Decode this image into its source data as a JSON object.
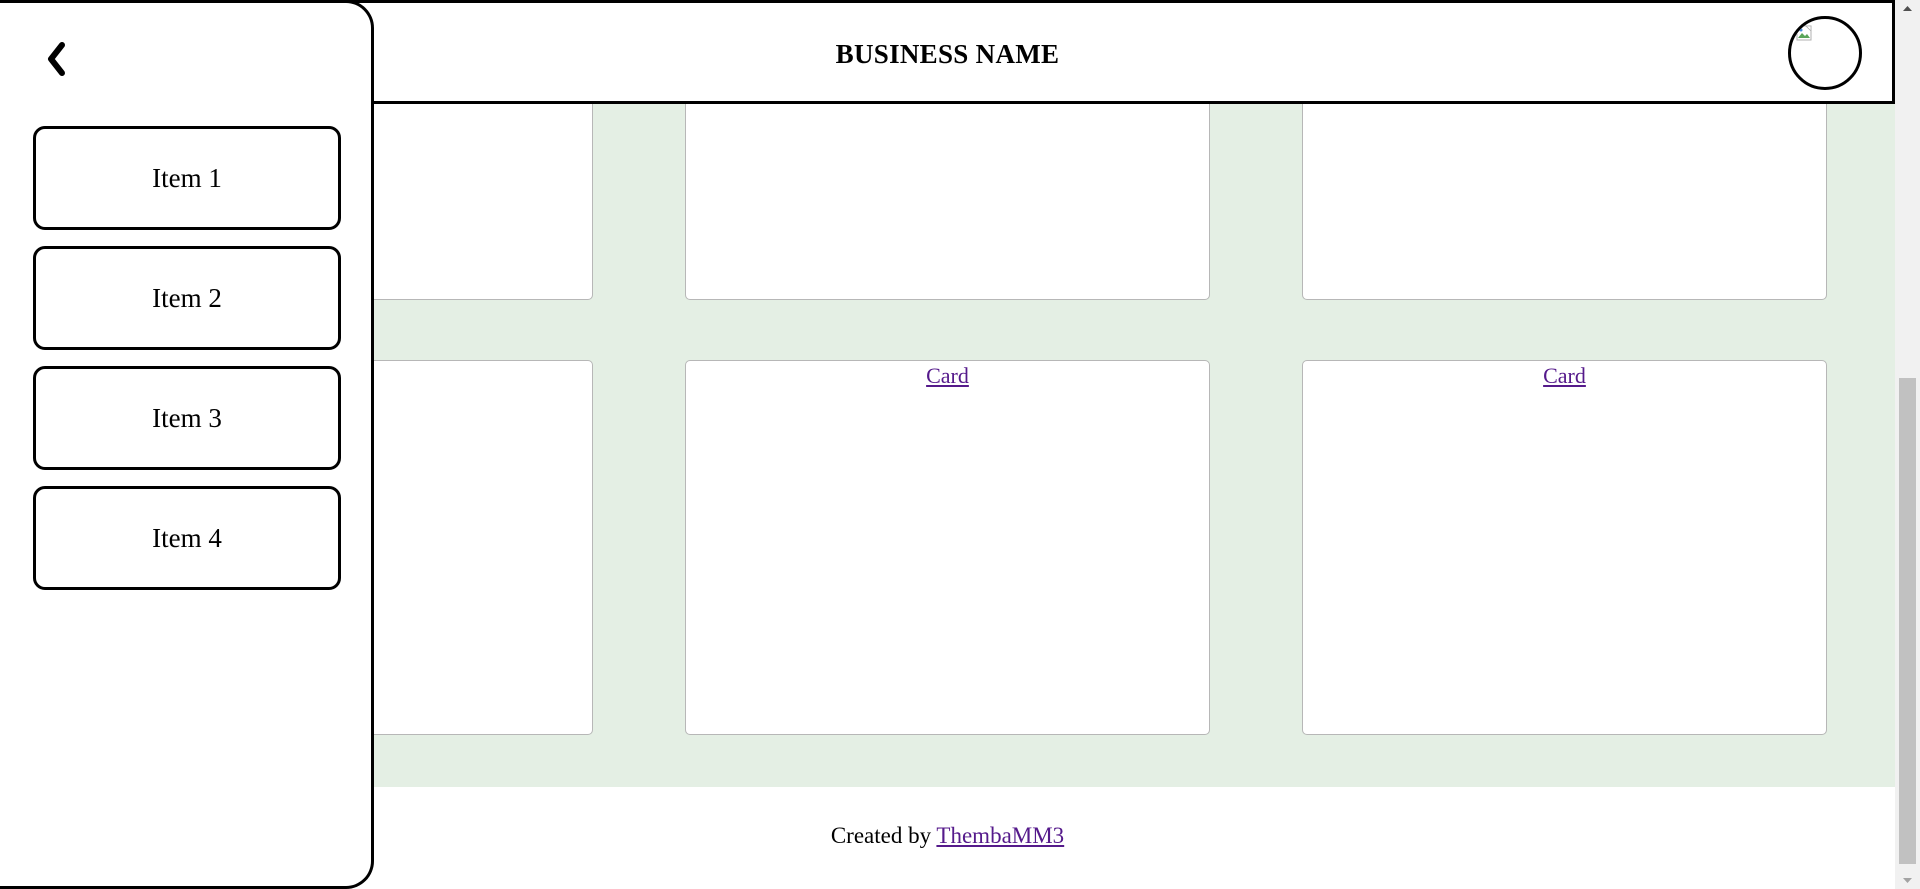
{
  "header": {
    "business_name": "BUSINESS NAME",
    "avatar_icon": "broken-image-icon"
  },
  "sidebar": {
    "back_icon": "chevron-left-icon",
    "items": [
      {
        "label": "Item 1"
      },
      {
        "label": "Item 2"
      },
      {
        "label": "Item 3"
      },
      {
        "label": "Item 4"
      }
    ]
  },
  "cards": [
    {
      "label": ""
    },
    {
      "label": ""
    },
    {
      "label": ""
    },
    {
      "label": ""
    },
    {
      "label": "Card"
    },
    {
      "label": "Card"
    }
  ],
  "footer": {
    "prefix": "Created by",
    "link_text": "ThembaMM3"
  },
  "colors": {
    "content_background": "#e4efe4",
    "link": "#551a8b",
    "border": "#000000"
  }
}
